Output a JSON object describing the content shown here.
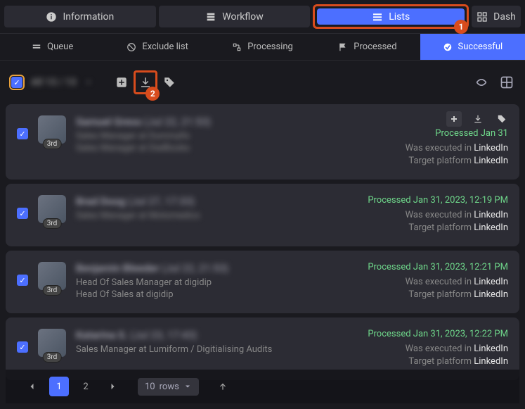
{
  "top_tabs": {
    "info": "Information",
    "workflow": "Workflow",
    "lists": "Lists",
    "dash": "Dash"
  },
  "sub_tabs": {
    "queue": "Queue",
    "exclude": "Exclude list",
    "processing": "Processing",
    "processed": "Processed",
    "successful": "Successful"
  },
  "steps": {
    "one": "1",
    "two": "2"
  },
  "selection_summary": "All 13 / 13",
  "contacts": [
    {
      "name": "Samuel Gress",
      "name_suffix": "(Jul 22, 21:53)",
      "line1": "Sales Manager at Dummyfix",
      "line2": "Sales Manager at DialBooks",
      "conn": "3rd",
      "processed": "Processed Jan 31",
      "exec_prefix": "Was executed in ",
      "exec_platform": "LinkedIn",
      "target_prefix": "Target platform ",
      "target_platform": "LinkedIn",
      "show_actions": true,
      "blur1": true,
      "blur2": true
    },
    {
      "name": "Brad Doog",
      "name_suffix": "(Jul 27, 17:33)",
      "line1": "Sales Manager at Motomedics",
      "line2": "",
      "conn": "3rd",
      "processed": "Processed Jan 31, 2023, 12:19 PM",
      "exec_prefix": "Was executed in ",
      "exec_platform": "LinkedIn",
      "target_prefix": "Target platform ",
      "target_platform": "LinkedIn",
      "show_actions": false,
      "blur1": true,
      "blur2": false
    },
    {
      "name": "Benjamin Bleeder",
      "name_suffix": "(Jul 22, 21:53)",
      "line1": "Head Of Sales Manager at digidip",
      "line2": "Head Of Sales at digidip",
      "conn": "3rd",
      "processed": "Processed Jan 31, 2023, 12:21 PM",
      "exec_prefix": "Was executed in ",
      "exec_platform": "LinkedIn",
      "target_prefix": "Target platform ",
      "target_platform": "LinkedIn",
      "show_actions": false,
      "blur1": false,
      "blur2": false
    },
    {
      "name": "Katarina S.",
      "name_suffix": "(Jul 23, 17:43)",
      "line1": "Sales Manager at Lumiform / Digitialising Audits",
      "line2": "",
      "conn": "3rd",
      "processed": "Processed Jan 31, 2023, 12:22 PM",
      "exec_prefix": "Was executed in ",
      "exec_platform": "LinkedIn",
      "target_prefix": "Target platform ",
      "target_platform": "LinkedIn",
      "show_actions": false,
      "blur1": false,
      "blur2": false
    }
  ],
  "meta_labels": {
    "exec_prefix": "Was executed in ",
    "target_prefix": "Target platform "
  },
  "pager": {
    "page1": "1",
    "page2": "2",
    "rows_value": "10",
    "rows_label": "rows"
  }
}
